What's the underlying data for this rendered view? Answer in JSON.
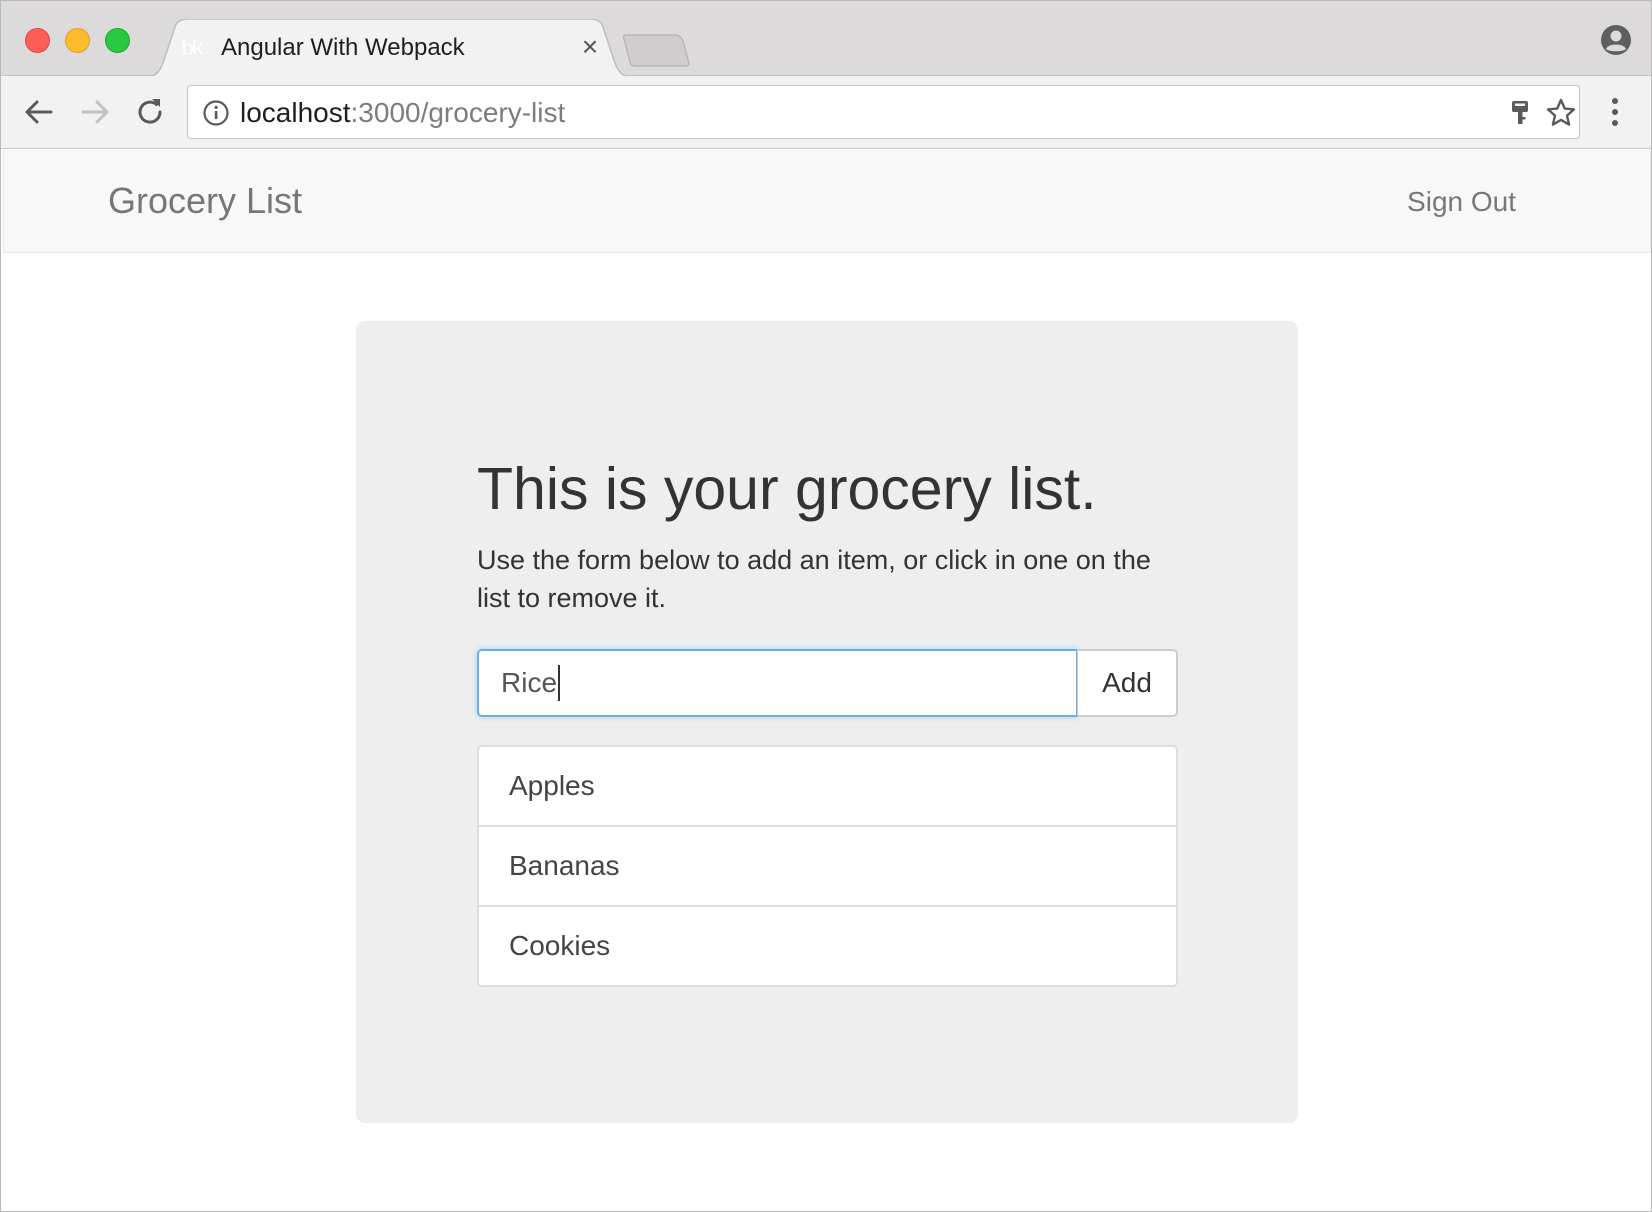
{
  "browser": {
    "tab_title": "Angular With Webpack",
    "tab_favicon_text": "bk",
    "tab_close_glyph": "×",
    "url_host": "localhost",
    "url_path": ":3000/grocery-list",
    "icons": [
      "back-arrow-icon",
      "forward-arrow-icon",
      "reload-icon",
      "info-icon",
      "key-icon",
      "star-icon",
      "menu-dots-icon",
      "profile-icon"
    ]
  },
  "navbar": {
    "brand": "Grocery List",
    "sign_out": "Sign Out"
  },
  "main": {
    "heading": "This is your grocery list.",
    "lead": "Use the form below to add an item, or click in one on the list to remove it.",
    "input_value": "Rice",
    "add_button": "Add",
    "items": [
      {
        "label": "Apples"
      },
      {
        "label": "Bananas"
      },
      {
        "label": "Cookies"
      }
    ]
  },
  "colors": {
    "input_focus": "#66afe9",
    "jumbotron_bg": "#eeeeee",
    "navbar_bg": "#f8f8f8"
  }
}
